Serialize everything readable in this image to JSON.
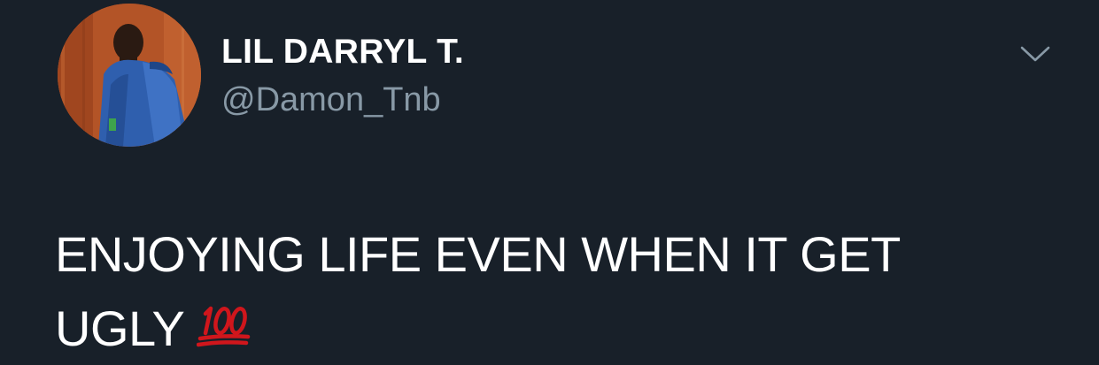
{
  "tweet": {
    "author": {
      "display_name": "LIL DARRYL T.",
      "handle": "@Damon_Tnb"
    },
    "text_line1": "ENJOYING LIFE EVEN WHEN IT GET",
    "text_line2": "UGLY",
    "emoji": "hundred-points-icon",
    "menu_icon": "chevron-down-icon"
  },
  "colors": {
    "background": "#182029",
    "text": "#ffffff",
    "handle": "#8899a6",
    "emoji": "#d0161c"
  }
}
